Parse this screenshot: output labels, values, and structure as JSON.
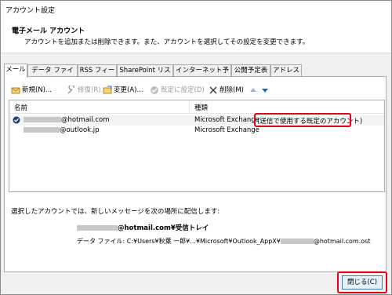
{
  "window": {
    "title": "アカウント設定"
  },
  "header": {
    "title": "電子メール アカウント",
    "subtitle": "アカウントを追加または削除できます。また、アカウントを選択してその設定を変更できます。"
  },
  "tabs": [
    "メール",
    "データ ファイル",
    "RSS フィード",
    "SharePoint リスト",
    "インターネット予定表",
    "公開予定表",
    "アドレス帳"
  ],
  "toolbar": {
    "new": "新規(N)...",
    "repair": "修復(R)...",
    "change": "変更(A)...",
    "default": "既定に設定(D)",
    "delete": "削除(M)"
  },
  "list": {
    "col_name": "名前",
    "col_type": "種類",
    "rows": [
      {
        "name": "@hotmail.com",
        "type": "Microsoft Exchange",
        "note": "(送信で使用する既定のアカウント)"
      },
      {
        "name": "@outlook.jp",
        "type": "Microsoft Exchange"
      }
    ]
  },
  "delivery": {
    "label": "選択したアカウントでは、新しいメッセージを次の場所に配信します:",
    "folder": "@hotmail.com¥受信トレイ",
    "data_file_prefix": "データ ファイル: C:¥Users¥秋葉 一郎¥...¥Microsoft¥Outlook_AppX¥",
    "data_file_suffix": "@hotmail.com.ost"
  },
  "close_button": "閉じる(C)",
  "colors": {
    "highlight": "#e0001b",
    "button_border": "#3c7fb1"
  }
}
